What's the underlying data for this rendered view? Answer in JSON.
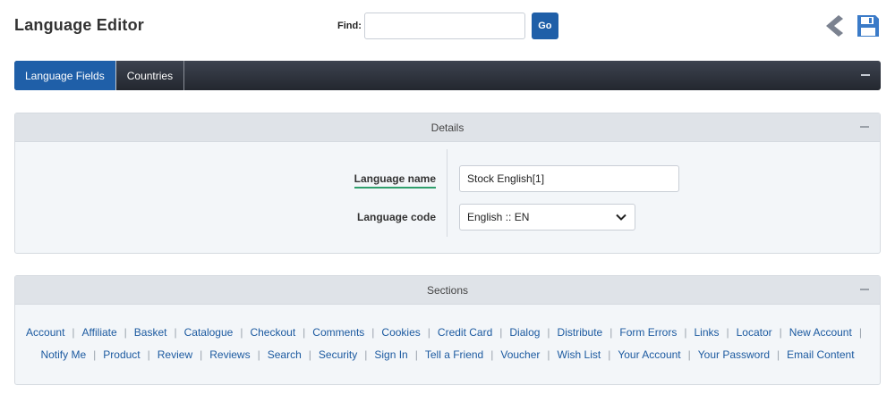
{
  "header": {
    "title": "Language Editor",
    "find_label": "Find:",
    "find_value": "",
    "go_label": "Go"
  },
  "tabs": [
    {
      "label": "Language Fields",
      "active": true
    },
    {
      "label": "Countries",
      "active": false
    }
  ],
  "details": {
    "title": "Details",
    "name_label": "Language name",
    "name_value": "Stock English[1]",
    "code_label": "Language code",
    "code_value": "English :: EN"
  },
  "sections": {
    "title": "Sections",
    "row1": [
      "Account",
      "Affiliate",
      "Basket",
      "Catalogue",
      "Checkout",
      "Comments",
      "Cookies",
      "Credit Card",
      "Dialog",
      "Distribute",
      "Form Errors",
      "Links",
      "Locator",
      "New Account"
    ],
    "row2": [
      "Notify Me",
      "Product",
      "Review",
      "Reviews",
      "Search",
      "Security",
      "Sign In",
      "Tell a Friend",
      "Voucher",
      "Wish List",
      "Your Account",
      "Your Password",
      "Email Content"
    ]
  },
  "colors": {
    "accent": "#1f5fa8",
    "link": "#1c5aa0",
    "label_underline": "#2e9f6c"
  },
  "icons": [
    "back-arrow-icon",
    "save-disk-icon",
    "chevron-down-icon",
    "collapse-minus-icon"
  ]
}
